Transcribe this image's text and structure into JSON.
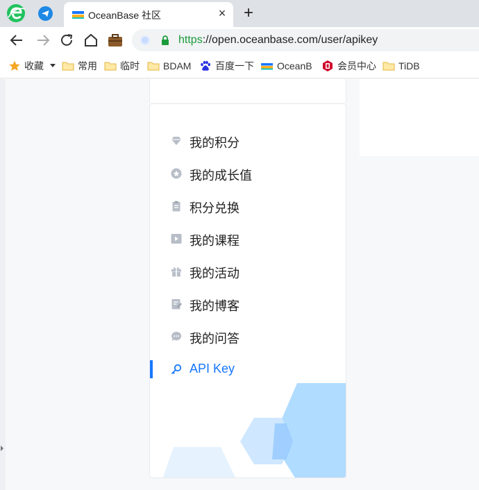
{
  "browser": {
    "tab": {
      "title": "OceanBase 社区",
      "close": "×"
    },
    "new_tab": "+",
    "url": {
      "scheme": "https",
      "rest": "://open.oceanbase.com/user/apikey"
    }
  },
  "bookmarks": [
    {
      "label": "收藏",
      "icon": "star-icon"
    },
    {
      "label": "常用",
      "icon": "folder-icon"
    },
    {
      "label": "临时",
      "icon": "folder-icon"
    },
    {
      "label": "BDAM",
      "icon": "folder-icon"
    },
    {
      "label": "百度一下",
      "icon": "baidu-icon"
    },
    {
      "label": "OceanB",
      "icon": "oceanbase-icon"
    },
    {
      "label": "会员中心",
      "icon": "huawei-icon"
    },
    {
      "label": "TiDB",
      "icon": "folder-icon"
    }
  ],
  "menu": {
    "items": [
      {
        "label": "我的积分",
        "icon": "diamond-icon",
        "active": false
      },
      {
        "label": "我的成长值",
        "icon": "star-badge-icon",
        "active": false
      },
      {
        "label": "积分兑换",
        "icon": "clipboard-icon",
        "active": false
      },
      {
        "label": "我的课程",
        "icon": "video-icon",
        "active": false
      },
      {
        "label": "我的活动",
        "icon": "gift-icon",
        "active": false
      },
      {
        "label": "我的博客",
        "icon": "edit-doc-icon",
        "active": false
      },
      {
        "label": "我的问答",
        "icon": "chat-bubble-icon",
        "active": false
      },
      {
        "label": "API Key",
        "icon": "key-icon",
        "active": true
      }
    ]
  },
  "colors": {
    "accent": "#1677ff",
    "icon_gray": "#b8bec8",
    "chrome_tabstrip": "#dee1e6",
    "page_bg": "#f7f8fa"
  }
}
